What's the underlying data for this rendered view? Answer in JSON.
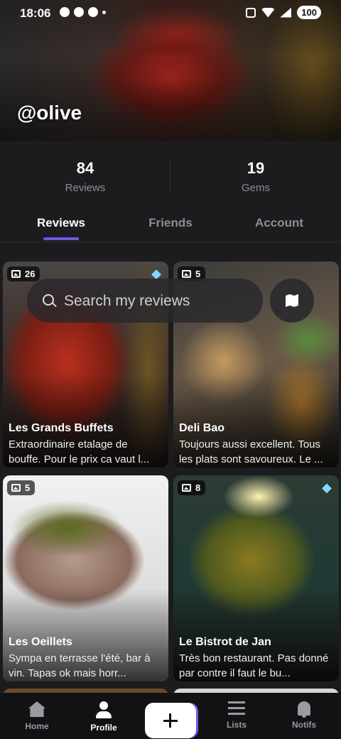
{
  "status_bar": {
    "time": "18:06",
    "battery": "100"
  },
  "profile": {
    "username": "@olive"
  },
  "stats": [
    {
      "value": "84",
      "label": "Reviews"
    },
    {
      "value": "19",
      "label": "Gems"
    }
  ],
  "tabs": [
    {
      "label": "Reviews",
      "active": true
    },
    {
      "label": "Friends",
      "active": false
    },
    {
      "label": "Account",
      "active": false
    }
  ],
  "search": {
    "placeholder": "Search my reviews"
  },
  "reviews": [
    {
      "photos": "26",
      "gem": true,
      "title": "Les Grands Buffets",
      "excerpt": "Extraordinaire etalage de bouffe. Pour le prix ca vaut l..."
    },
    {
      "photos": "5",
      "gem": false,
      "title": "Deli Bao",
      "excerpt": "Toujours aussi excellent. Tous les plats sont savoureux. Le ..."
    },
    {
      "photos": "5",
      "gem": false,
      "title": "Les Oeillets",
      "excerpt": "Sympa en terrasse l'été, bar à vin. Tapas ok mais horr..."
    },
    {
      "photos": "8",
      "gem": true,
      "title": "Le Bistrot de Jan",
      "excerpt": "Très bon restaurant. Pas donné par contre il faut le bu..."
    }
  ],
  "nav": [
    {
      "label": "Home",
      "icon": "home-icon"
    },
    {
      "label": "Profile",
      "icon": "person-icon",
      "active": true
    },
    {
      "label": "",
      "icon": "plus-icon"
    },
    {
      "label": "Lists",
      "icon": "list-icon"
    },
    {
      "label": "Notifs",
      "icon": "bell-icon"
    }
  ],
  "colors": {
    "accent": "#6d5ae6",
    "gem": "#7fd7ff",
    "background": "#1c1c1f"
  }
}
